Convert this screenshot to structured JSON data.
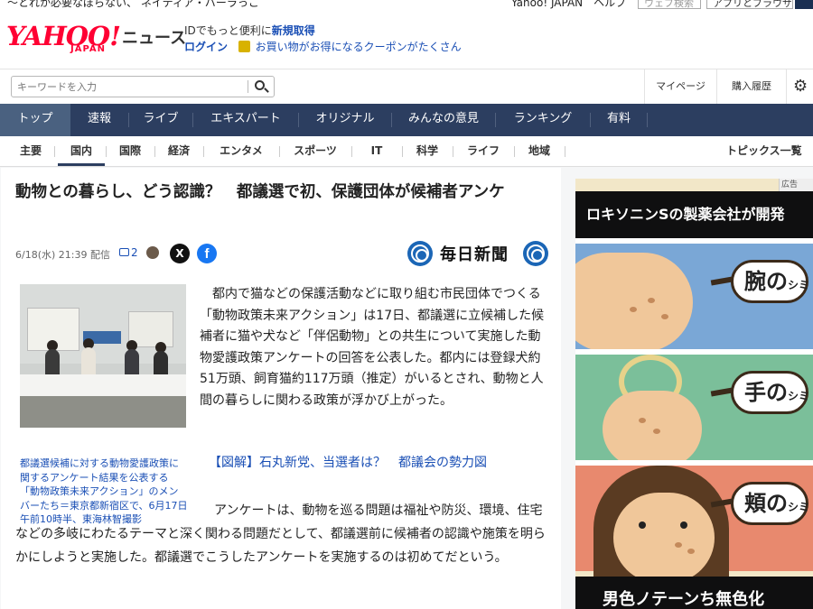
{
  "topstrip": {
    "left_text": "〜とれか必要なぽらない、 ネイティア・バーラっこ",
    "right_text": "Yahoo! JAPAN　ヘルプ",
    "box1": "ウェブ検索",
    "box2": "アプリとブラウザ拡張"
  },
  "header": {
    "logo": "YAHOO!",
    "logo_sub": "JAPAN",
    "service": "ニュース",
    "promo_prefix": "IDでもっと便利に",
    "promo_link": "新規取得",
    "login": "ログイン",
    "coupon": "お買い物がお得になるクーポンがたくさん"
  },
  "search": {
    "placeholder": "キーワードを入力",
    "mypage": "マイページ",
    "history": "購入履歴",
    "settings_icon": "gear-icon"
  },
  "main_nav": [
    "トップ",
    "速報",
    "ライブ",
    "エキスパート",
    "オリジナル",
    "みんなの意見",
    "ランキング",
    "有料"
  ],
  "sub_nav": [
    "主要",
    "国内",
    "国際",
    "経済",
    "エンタメ",
    "スポーツ",
    "IT",
    "科学",
    "ライフ",
    "地域"
  ],
  "topics_link": "トピックス一覧",
  "article": {
    "title": "動物との暮らし、どう認識？　都議選で初、保護団体が候補者アンケ",
    "date": "6/18(水) 21:39 配信",
    "comment_count": "2",
    "share_x": "X",
    "share_fb": "f",
    "source": "毎日新聞",
    "photo_caption": "都議選候補に対する動物愛護政策に関するアンケート結果を公表する「動物政策未来アクション」のメンバーたち＝東京都新宿区で、6月17日午前10時半、東海林智撮影",
    "paragraph1": "都内で猫などの保護活動などに取り組む市民団体でつくる「動物政策未来アクション」は17日、都議選に立候補した候補者に猫や犬など「伴侶動物」との共生について実施した動物愛護政策アンケートの回答を公表した。都内には登録犬約51万頭、飼育猫約117万頭（推定）がいるとされ、動物と人間の暮らしに関わる政策が浮かび上がった。",
    "related_link": "【図解】石丸新党、当選者は？　都議会の勢力図",
    "paragraph2": "アンケートは、動物を巡る問題は福祉や防災、環境、住宅などの多岐にわたるテーマと深く関わる問題だとして、都議選前に候補者の認識や施策を明らかにしようと実施した。都議選でこうしたアンケートを実施するのは初めてだという。"
  },
  "ad": {
    "label": "広告",
    "banner": "ロキソニンSの製薬会社が開発",
    "tag1": "腕の",
    "tag2": "手の",
    "tag3": "頬の",
    "tag_suffix": "シミ",
    "bottom": "男色ノテーンち無色化"
  }
}
